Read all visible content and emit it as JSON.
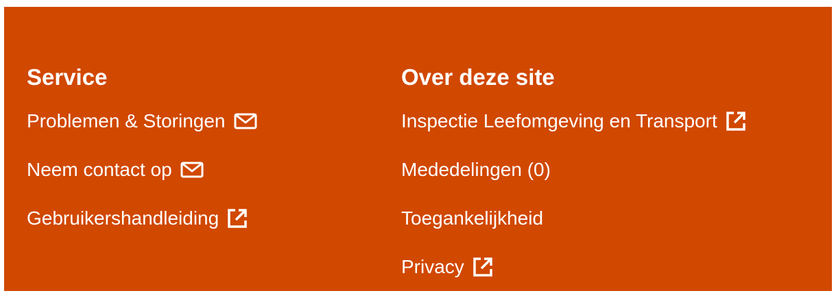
{
  "colors": {
    "footer_background": "#d14800",
    "text": "#ffffff"
  },
  "service": {
    "title": "Service",
    "links": [
      {
        "label": "Problemen & Storingen",
        "icon": "mail-icon"
      },
      {
        "label": "Neem contact op",
        "icon": "mail-icon"
      },
      {
        "label": "Gebruikershandleiding",
        "icon": "external-link-icon"
      }
    ]
  },
  "about": {
    "title": "Over deze site",
    "links": [
      {
        "label": "Inspectie Leefomgeving en Transport",
        "icon": "external-link-icon"
      },
      {
        "label": "Mededelingen (0)",
        "icon": ""
      },
      {
        "label": "Toegankelijkheid",
        "icon": ""
      },
      {
        "label": "Privacy",
        "icon": "external-link-icon"
      }
    ]
  }
}
